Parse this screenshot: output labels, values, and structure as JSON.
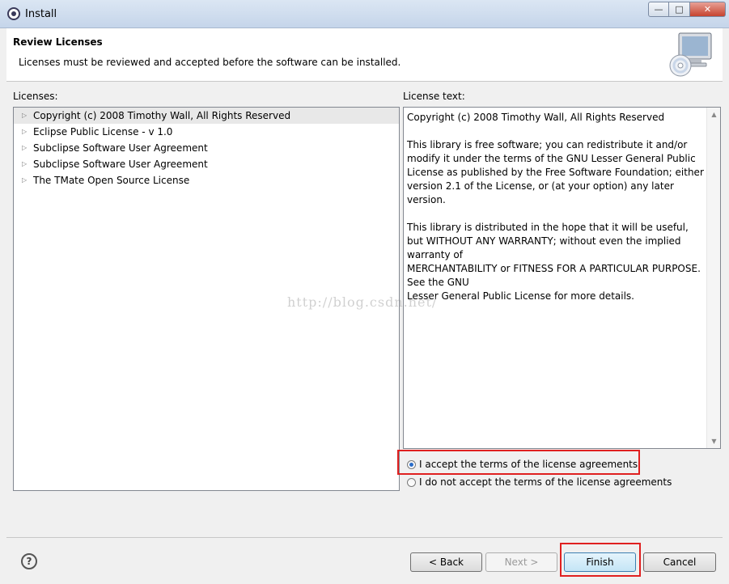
{
  "window": {
    "title": "Install"
  },
  "header": {
    "title": "Review Licenses",
    "description": "Licenses must be reviewed and accepted before the software can be installed."
  },
  "licenses": {
    "label": "Licenses:",
    "items": [
      "Copyright (c) 2008 Timothy Wall, All Rights Reserved",
      "Eclipse Public License - v 1.0",
      "Subclipse Software User Agreement",
      "Subclipse Software User Agreement",
      "The TMate Open Source License"
    ],
    "selected_index": 0
  },
  "license_text": {
    "label": "License text:",
    "content": "Copyright (c) 2008 Timothy Wall, All Rights Reserved\n\nThis library is free software; you can redistribute it and/or\nmodify it under the terms of the GNU Lesser General Public\nLicense as published by the Free Software Foundation; either\nversion 2.1 of the License, or (at your option) any later version.\n\nThis library is distributed in the hope that it will be useful,\nbut WITHOUT ANY WARRANTY; without even the implied\nwarranty of\nMERCHANTABILITY or FITNESS FOR A PARTICULAR PURPOSE.\nSee the GNU\nLesser General Public License for more details."
  },
  "options": {
    "accept": "I accept the terms of the license agreements",
    "decline": "I do not accept the terms of the license agreements",
    "selected": "accept"
  },
  "watermark": "http://blog.csdn.net/",
  "buttons": {
    "back": "< Back",
    "next": "Next >",
    "finish": "Finish",
    "cancel": "Cancel"
  },
  "colors": {
    "highlight": "#e02020",
    "radio_selected": "#2a6dc9"
  }
}
